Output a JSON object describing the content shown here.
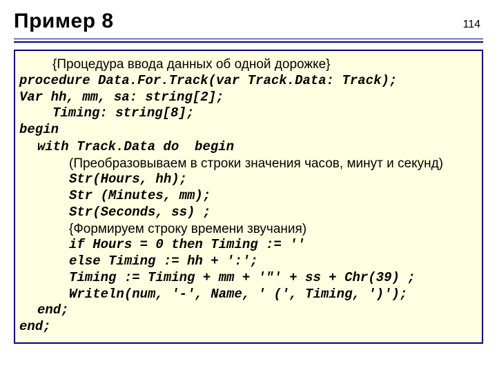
{
  "page_number": "114",
  "title": "Пример 8",
  "code": {
    "l1": "{Процедура ввода данных об одной дорожке}",
    "l2": "procedure Data.For.Track(var Track.Data: Track);",
    "l3": "Var hh, mm, sa: string[2];",
    "l4": "Timing: string[8];",
    "l5": "begin",
    "l6a": "with Track.Data do",
    "l6b": "begin",
    "l7": "(Преобразовываем в строки значения часов, минут и секунд)",
    "l8": "Str(Hours, hh);",
    "l9": "Str (Minutes, mm);",
    "l10": "Str(Seconds, ss) ;",
    "l11": "{Формируем строку времени звучания)",
    "l12": "if Hours = 0 then Timing := ''",
    "l13": "else Timing := hh + ':';",
    "l14": "Timing := Timing + mm + '\"' + ss + Chr(39) ;",
    "l15": "Writeln(num, '-', Name, ' (', Timing, ')');",
    "l16": "end;",
    "l17": "end;"
  }
}
